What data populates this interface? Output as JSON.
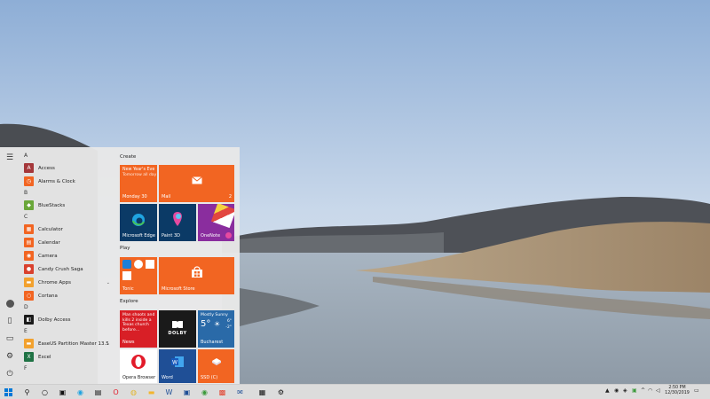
{
  "start_menu": {
    "app_list": [
      {
        "letter": "A",
        "apps": [
          {
            "name": "Access",
            "icon": "access-icon",
            "color": "#a4373a",
            "glyph": "A"
          },
          {
            "name": "Alarms & Clock",
            "icon": "alarm-clock-icon",
            "color": "#f26522",
            "glyph": "◷"
          }
        ]
      },
      {
        "letter": "B",
        "apps": [
          {
            "name": "BlueStacks",
            "icon": "bluestacks-icon",
            "color": "#6aa73a",
            "glyph": "◆"
          }
        ]
      },
      {
        "letter": "C",
        "apps": [
          {
            "name": "Calculator",
            "icon": "calculator-icon",
            "color": "#f26522",
            "glyph": "▦"
          },
          {
            "name": "Calendar",
            "icon": "calendar-icon",
            "color": "#f26522",
            "glyph": "▤"
          },
          {
            "name": "Camera",
            "icon": "camera-icon",
            "color": "#f26522",
            "glyph": "◉"
          },
          {
            "name": "Candy Crush Saga",
            "icon": "candy-crush-icon",
            "color": "#d9412e",
            "glyph": "●"
          },
          {
            "name": "Chrome Apps",
            "icon": "folder-icon",
            "color": "#f2a12e",
            "glyph": "▬",
            "expandable": true,
            "chevron": "⌄"
          },
          {
            "name": "Cortana",
            "icon": "cortana-icon",
            "color": "#f26522",
            "glyph": "○"
          }
        ]
      },
      {
        "letter": "D",
        "apps": [
          {
            "name": "Dolby Access",
            "icon": "dolby-icon",
            "color": "#1a1a1a",
            "glyph": "◧"
          }
        ]
      },
      {
        "letter": "E",
        "apps": [
          {
            "name": "EaseUS Partition Master 13.5",
            "icon": "folder-icon",
            "color": "#f2a12e",
            "glyph": "▬",
            "expandable": true,
            "chevron": "⌄"
          },
          {
            "name": "Excel",
            "icon": "excel-icon",
            "color": "#1f7244",
            "glyph": "X"
          }
        ]
      },
      {
        "letter": "F",
        "apps": []
      }
    ],
    "groups": {
      "create": "Create",
      "play": "Play",
      "explore": "Explore"
    },
    "tiles": {
      "calendar_event": "New Year's Eve",
      "calendar_sub": "Tomorrow all day",
      "calendar_date": "Monday 30",
      "mail": "Mail",
      "mail_count": "2",
      "edge": "Microsoft Edge",
      "paint3d": "Paint 3D",
      "onenote": "OneNote",
      "games": "Tonic",
      "store": "Microsoft Store",
      "news_headline": "Man shoots and kills 2 inside a Texas church before…",
      "news": "News",
      "dolby_logo": "DOLBY",
      "weather_cond": "Mostly Sunny",
      "weather_temp": "5°",
      "weather_hi": "6°",
      "weather_lo": "-2°",
      "weather_city": "Bucharest",
      "opera": "Opera Browser",
      "word": "Word",
      "ssd": "SSD (C)"
    }
  },
  "taskbar": {
    "start_icon": "windows-logo-icon",
    "tray_expand": "^",
    "clock_time": "2:50 PM",
    "clock_date": "12/30/2019"
  }
}
